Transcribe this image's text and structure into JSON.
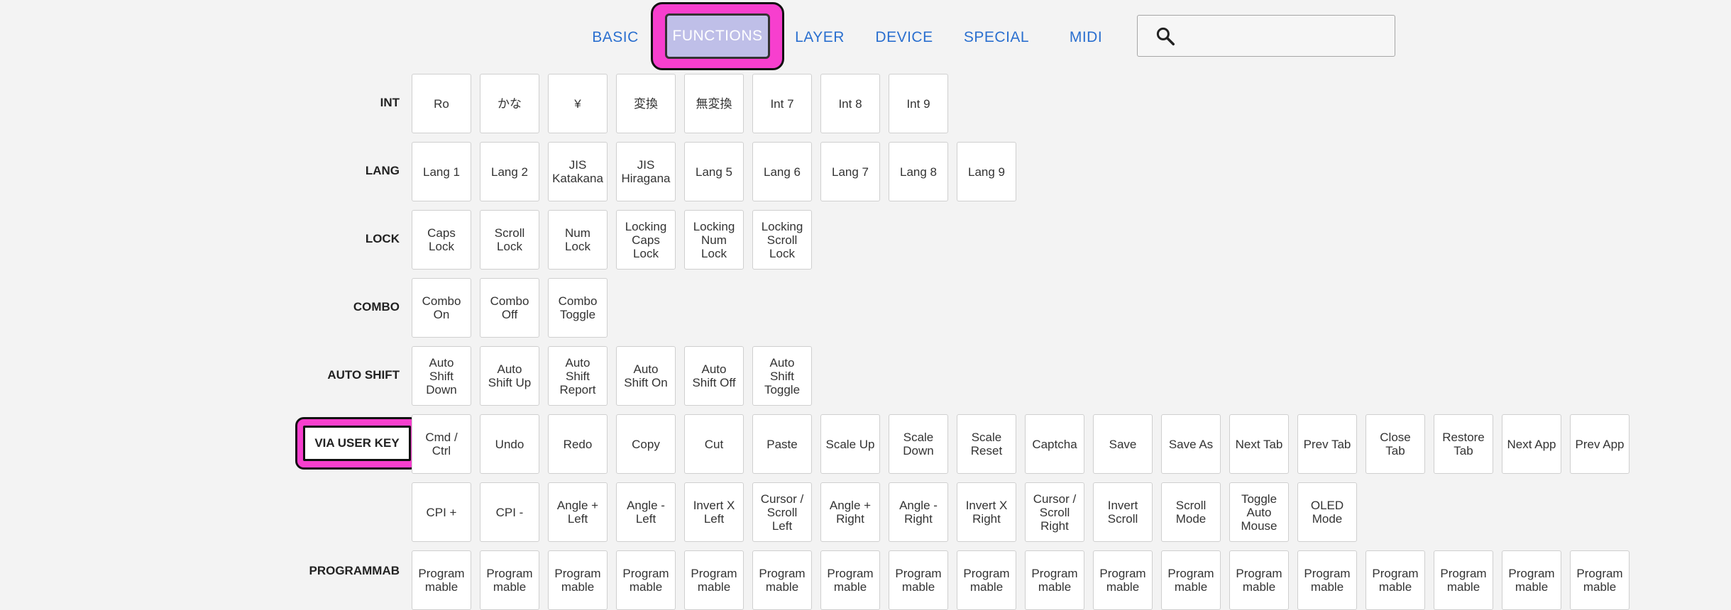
{
  "tabs": [
    {
      "label": "BASIC"
    },
    {
      "label": "FUNCTIONS"
    },
    {
      "label": "LAYER"
    },
    {
      "label": "DEVICE"
    },
    {
      "label": "SPECIAL"
    },
    {
      "label": "MIDI"
    }
  ],
  "active_tab": "FUNCTIONS",
  "search": {
    "placeholder": "",
    "value": ""
  },
  "sections": {
    "int": {
      "label": "INT",
      "keys": [
        "Ro",
        "かな",
        "¥",
        "変換",
        "無変換",
        "Int 7",
        "Int 8",
        "Int 9"
      ]
    },
    "lang": {
      "label": "LANG",
      "keys": [
        "Lang 1",
        "Lang 2",
        "JIS\nKatakana",
        "JIS\nHiragana",
        "Lang 5",
        "Lang 6",
        "Lang 7",
        "Lang 8",
        "Lang 9"
      ]
    },
    "lock": {
      "label": "LOCK",
      "keys": [
        "Caps\nLock",
        "Scroll\nLock",
        "Num\nLock",
        "Locking\nCaps\nLock",
        "Locking\nNum\nLock",
        "Locking\nScroll\nLock"
      ]
    },
    "combo": {
      "label": "COMBO",
      "keys": [
        "Combo\nOn",
        "Combo\nOff",
        "Combo\nToggle"
      ]
    },
    "autoshift": {
      "label": "AUTO SHIFT",
      "keys": [
        "Auto\nShift\nDown",
        "Auto\nShift Up",
        "Auto\nShift\nReport",
        "Auto\nShift On",
        "Auto\nShift Off",
        "Auto\nShift\nToggle"
      ]
    },
    "via": {
      "label": "VIA USER KEY",
      "keys": [
        "Cmd /\nCtrl",
        "Undo",
        "Redo",
        "Copy",
        "Cut",
        "Paste",
        "Scale Up",
        "Scale\nDown",
        "Scale\nReset",
        "Captcha",
        "Save",
        "Save As",
        "Next Tab",
        "Prev Tab",
        "Close\nTab",
        "Restore\nTab",
        "Next App",
        "Prev App"
      ]
    },
    "via2": {
      "label": "",
      "keys": [
        "CPI +",
        "CPI -",
        "Angle +\nLeft",
        "Angle -\nLeft",
        "Invert X\nLeft",
        "Cursor /\nScroll\nLeft",
        "Angle +\nRight",
        "Angle -\nRight",
        "Invert X\nRight",
        "Cursor /\nScroll\nRight",
        "Invert\nScroll",
        "Scroll\nMode",
        "Toggle\nAuto\nMouse",
        "OLED\nMode"
      ]
    },
    "prog": {
      "label": "PROGRAMMAB",
      "keys": [
        "Program\nmable",
        "Program\nmable",
        "Program\nmable",
        "Program\nmable",
        "Program\nmable",
        "Program\nmable",
        "Program\nmable",
        "Program\nmable",
        "Program\nmable",
        "Program\nmable",
        "Program\nmable",
        "Program\nmable",
        "Program\nmable",
        "Program\nmable",
        "Program\nmable",
        "Program\nmable",
        "Program\nmable",
        "Program\nmable"
      ]
    }
  },
  "colors": {
    "highlight": "#f73fce",
    "tab_text": "#2a6fcf",
    "active_tab_bg": "#bfbfe8"
  }
}
